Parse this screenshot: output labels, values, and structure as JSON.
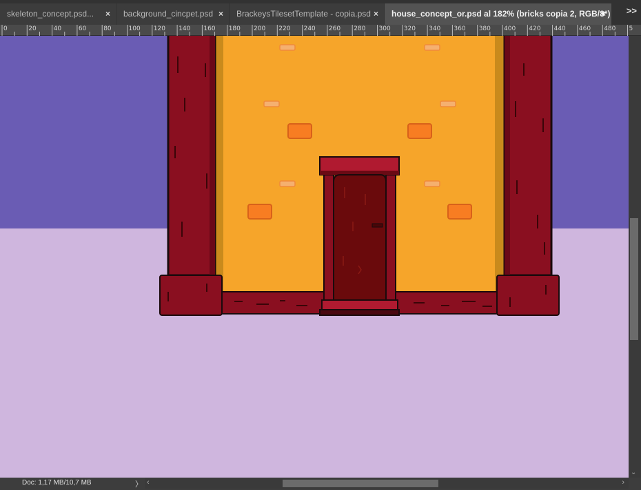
{
  "tabs": [
    {
      "label": "skeleton_concept.psd...",
      "close": "×"
    },
    {
      "label": "background_cincpet.psd",
      "close": "×"
    },
    {
      "label": "BrackeysTilesetTemplate - copia.psd",
      "close": "×"
    },
    {
      "label": "house_concept_or.psd al 182% (bricks copia 2, RGB/8*) *",
      "close": "×"
    }
  ],
  "overflow_icon": ">>",
  "ruler": {
    "labels": [
      "0",
      "20",
      "40",
      "60",
      "80",
      "100",
      "120",
      "140",
      "160",
      "180",
      "200",
      "220",
      "240",
      "260",
      "280",
      "300",
      "320",
      "340",
      "360",
      "380",
      "400",
      "420",
      "440",
      "460",
      "480",
      "5"
    ]
  },
  "status": {
    "doc": "Doc: 1,17 MB/10,7 MB",
    "arrow": "〉"
  },
  "colors": {
    "sky": "#6a5cb4",
    "ground": "#cfb6de",
    "wall": "#f6a52a",
    "wall_shadow": "#c98a1c",
    "pillar": "#8a0f20",
    "outline": "#1a0a0c",
    "door": "#6a0a0c",
    "door_frame": "#b01a30",
    "brick_orange": "#f87d22",
    "brick_light": "#f5b070"
  },
  "icons": {
    "close": "close-icon",
    "overflow": "chevron-double-right-icon",
    "scroll_left": "chevron-left-icon",
    "scroll_right": "chevron-right-icon",
    "scroll_down": "chevron-down-icon"
  }
}
